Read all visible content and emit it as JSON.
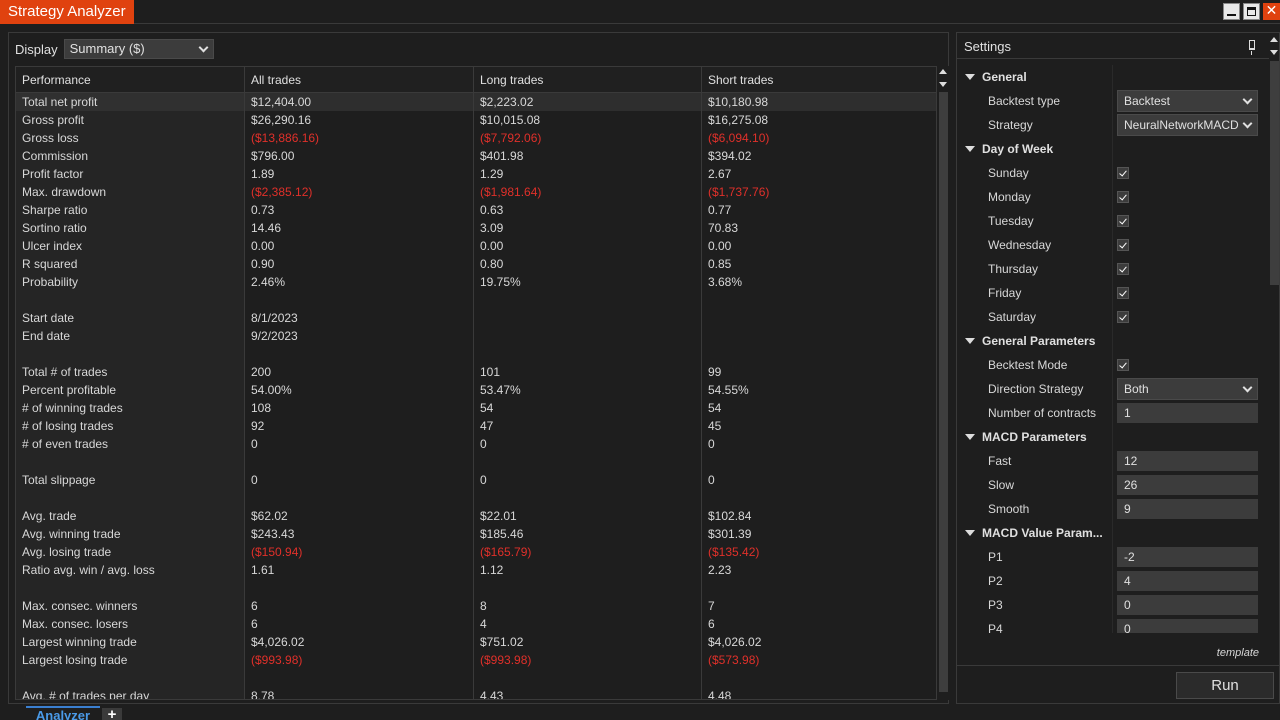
{
  "window": {
    "title": "Strategy Analyzer",
    "accent_color": "#e0420f"
  },
  "display": {
    "label": "Display",
    "selected": "Summary ($)"
  },
  "table": {
    "columns": [
      "Performance",
      "All trades",
      "Long trades",
      "Short trades"
    ],
    "rows": [
      {
        "label": "Total net profit",
        "all": "$12,404.00",
        "long": "$2,223.02",
        "short": "$10,180.98"
      },
      {
        "label": "Gross profit",
        "all": "$26,290.16",
        "long": "$10,015.08",
        "short": "$16,275.08"
      },
      {
        "label": "Gross loss",
        "all": "($13,886.16)",
        "long": "($7,792.06)",
        "short": "($6,094.10)"
      },
      {
        "label": "Commission",
        "all": "$796.00",
        "long": "$401.98",
        "short": "$394.02"
      },
      {
        "label": "Profit factor",
        "all": "1.89",
        "long": "1.29",
        "short": "2.67"
      },
      {
        "label": "Max. drawdown",
        "all": "($2,385.12)",
        "long": "($1,981.64)",
        "short": "($1,737.76)"
      },
      {
        "label": "Sharpe ratio",
        "all": "0.73",
        "long": "0.63",
        "short": "0.77"
      },
      {
        "label": "Sortino ratio",
        "all": "14.46",
        "long": "3.09",
        "short": "70.83"
      },
      {
        "label": "Ulcer index",
        "all": "0.00",
        "long": "0.00",
        "short": "0.00"
      },
      {
        "label": "R squared",
        "all": "0.90",
        "long": "0.80",
        "short": "0.85"
      },
      {
        "label": "Probability",
        "all": "2.46%",
        "long": "19.75%",
        "short": "3.68%"
      },
      {
        "label": "",
        "all": "",
        "long": "",
        "short": ""
      },
      {
        "label": "Start date",
        "all": "8/1/2023",
        "long": "",
        "short": ""
      },
      {
        "label": "End date",
        "all": "9/2/2023",
        "long": "",
        "short": ""
      },
      {
        "label": "",
        "all": "",
        "long": "",
        "short": ""
      },
      {
        "label": "Total # of trades",
        "all": "200",
        "long": "101",
        "short": "99"
      },
      {
        "label": "Percent profitable",
        "all": "54.00%",
        "long": "53.47%",
        "short": "54.55%"
      },
      {
        "label": "# of winning trades",
        "all": "108",
        "long": "54",
        "short": "54"
      },
      {
        "label": "# of losing trades",
        "all": "92",
        "long": "47",
        "short": "45"
      },
      {
        "label": "# of even trades",
        "all": "0",
        "long": "0",
        "short": "0"
      },
      {
        "label": "",
        "all": "",
        "long": "",
        "short": ""
      },
      {
        "label": "Total slippage",
        "all": "0",
        "long": "0",
        "short": "0"
      },
      {
        "label": "",
        "all": "",
        "long": "",
        "short": ""
      },
      {
        "label": "Avg. trade",
        "all": "$62.02",
        "long": "$22.01",
        "short": "$102.84"
      },
      {
        "label": "Avg. winning trade",
        "all": "$243.43",
        "long": "$185.46",
        "short": "$301.39"
      },
      {
        "label": "Avg. losing trade",
        "all": "($150.94)",
        "long": "($165.79)",
        "short": "($135.42)"
      },
      {
        "label": "Ratio avg. win / avg. loss",
        "all": "1.61",
        "long": "1.12",
        "short": "2.23"
      },
      {
        "label": "",
        "all": "",
        "long": "",
        "short": ""
      },
      {
        "label": "Max. consec. winners",
        "all": "6",
        "long": "8",
        "short": "7"
      },
      {
        "label": "Max. consec. losers",
        "all": "6",
        "long": "4",
        "short": "6"
      },
      {
        "label": "Largest winning trade",
        "all": "$4,026.02",
        "long": "$751.02",
        "short": "$4,026.02"
      },
      {
        "label": "Largest losing trade",
        "all": "($993.98)",
        "long": "($993.98)",
        "short": "($573.98)"
      },
      {
        "label": "",
        "all": "",
        "long": "",
        "short": ""
      },
      {
        "label": "Avg. # of trades per day",
        "all": "8.78",
        "long": "4.43",
        "short": "4.48"
      }
    ]
  },
  "settings": {
    "title": "Settings",
    "sections": [
      {
        "label": "General",
        "props": [
          {
            "label": "Backtest type",
            "type": "select",
            "value": "Backtest"
          },
          {
            "label": "Strategy",
            "type": "select",
            "value": "NeuralNetworkMACD"
          }
        ]
      },
      {
        "label": "Day of Week",
        "props": [
          {
            "label": "Sunday",
            "type": "check",
            "value": "checked"
          },
          {
            "label": "Monday",
            "type": "check",
            "value": "checked"
          },
          {
            "label": "Tuesday",
            "type": "check",
            "value": "checked"
          },
          {
            "label": "Wednesday",
            "type": "check",
            "value": "checked"
          },
          {
            "label": "Thursday",
            "type": "check",
            "value": "checked"
          },
          {
            "label": "Friday",
            "type": "check",
            "value": "checked"
          },
          {
            "label": "Saturday",
            "type": "check",
            "value": "checked"
          }
        ]
      },
      {
        "label": "General Parameters",
        "props": [
          {
            "label": "Becktest Mode",
            "type": "check",
            "value": "checked"
          },
          {
            "label": "Direction Strategy",
            "type": "select",
            "value": "Both"
          },
          {
            "label": "Number of contracts",
            "type": "input",
            "value": "1"
          }
        ]
      },
      {
        "label": "MACD Parameters",
        "props": [
          {
            "label": "Fast",
            "type": "input",
            "value": "12"
          },
          {
            "label": "Slow",
            "type": "input",
            "value": "26"
          },
          {
            "label": "Smooth",
            "type": "input",
            "value": "9"
          }
        ]
      },
      {
        "label": "MACD Value Param...",
        "props": [
          {
            "label": "P1",
            "type": "input",
            "value": "-2"
          },
          {
            "label": "P2",
            "type": "input",
            "value": "4"
          },
          {
            "label": "P3",
            "type": "input",
            "value": "0"
          },
          {
            "label": "P4",
            "type": "input",
            "value": "0"
          }
        ]
      }
    ],
    "template_link": "template",
    "run_label": "Run"
  },
  "tabs": {
    "active": "Analyzer",
    "add": "+"
  }
}
